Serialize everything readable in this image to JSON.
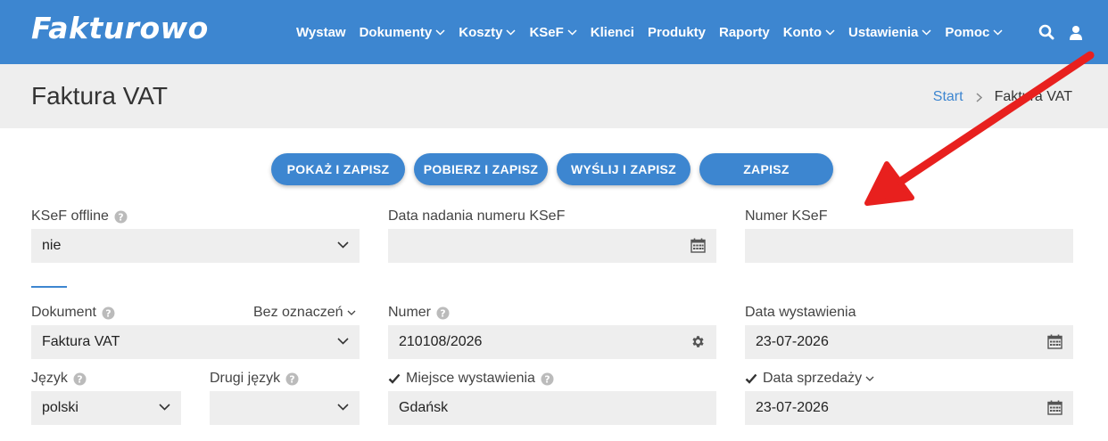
{
  "brand": {
    "logo": "Fakturowo"
  },
  "nav": {
    "items": [
      {
        "label": "Wystaw",
        "dropdown": false
      },
      {
        "label": "Dokumenty",
        "dropdown": true
      },
      {
        "label": "Koszty",
        "dropdown": true
      },
      {
        "label": "KSeF",
        "dropdown": true
      },
      {
        "label": "Klienci",
        "dropdown": false
      },
      {
        "label": "Produkty",
        "dropdown": false
      },
      {
        "label": "Raporty",
        "dropdown": false
      },
      {
        "label": "Konto",
        "dropdown": true
      },
      {
        "label": "Ustawienia",
        "dropdown": true
      },
      {
        "label": "Pomoc",
        "dropdown": true
      }
    ]
  },
  "page": {
    "title": "Faktura VAT",
    "breadcrumb": {
      "home": "Start",
      "current": "Faktura VAT"
    }
  },
  "actions": {
    "show_save": "POKAŻ I ZAPISZ",
    "download_save": "POBIERZ I ZAPISZ",
    "send_save": "WYŚLIJ I ZAPISZ",
    "save": "ZAPISZ"
  },
  "form": {
    "ksef_offline": {
      "label": "KSeF offline",
      "value": "nie"
    },
    "ksef_date": {
      "label": "Data nadania numeru KSeF",
      "value": ""
    },
    "ksef_number": {
      "label": "Numer KSeF",
      "value": ""
    },
    "document": {
      "label": "Dokument",
      "marking": "Bez oznaczeń",
      "value": "Faktura VAT"
    },
    "number": {
      "label": "Numer",
      "value": "210108/2026"
    },
    "issue_date": {
      "label": "Data wystawienia",
      "value": "23-07-2026"
    },
    "language": {
      "label": "Język",
      "value": "polski"
    },
    "second_language": {
      "label": "Drugi język",
      "value": ""
    },
    "place": {
      "label": "Miejsce wystawienia",
      "value": "Gdańsk",
      "checked": true
    },
    "sale_date": {
      "label": "Data sprzedaży",
      "value": "23-07-2026",
      "checked": true
    }
  },
  "colors": {
    "primary": "#3d86d0",
    "annotation_arrow": "#e8201e"
  }
}
